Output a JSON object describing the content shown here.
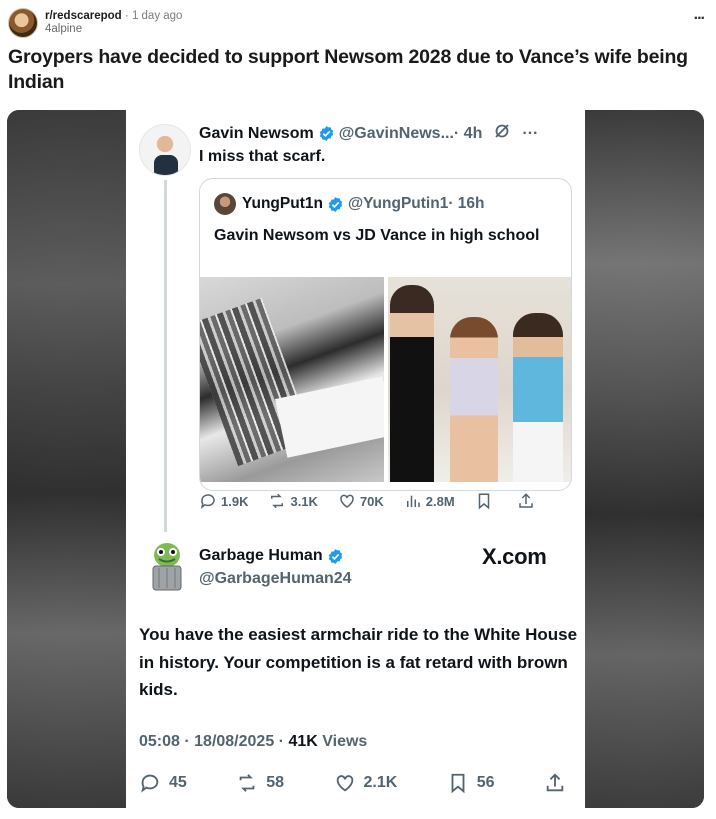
{
  "post": {
    "subreddit": "r/redscarepod",
    "age": "1 day ago",
    "username": "4alpine",
    "overflow": "...",
    "title": "Groypers have decided to support Newsom 2028 due to Vance’s wife being Indian"
  },
  "tweet1": {
    "name": "Gavin Newsom",
    "handle": "@GavinNews...",
    "time": "· 4h",
    "text": "I miss that scarf.",
    "quote": {
      "name": "YungPut1n",
      "handle": "@YungPutin1",
      "time": "· 16h",
      "text": "Gavin Newsom vs JD Vance in high school"
    },
    "replies": "1.9K",
    "reposts": "3.1K",
    "likes": "70K",
    "views": "2.8M"
  },
  "tweet2": {
    "name": "Garbage Human",
    "handle": "@GarbageHuman24",
    "watermark": "X.com",
    "text": "You have the easiest armchair ride to the White House in history. Your competition is a fat retard with brown kids.",
    "timestamp": "05:08 · 18/08/2025 · ",
    "views_count": "41K",
    "views_label": " Views",
    "replies": "45",
    "reposts": "58",
    "likes": "2.1K",
    "bookmarks": "56"
  },
  "colors": {
    "verified": "#1d9bf0",
    "muted": "#536471"
  }
}
